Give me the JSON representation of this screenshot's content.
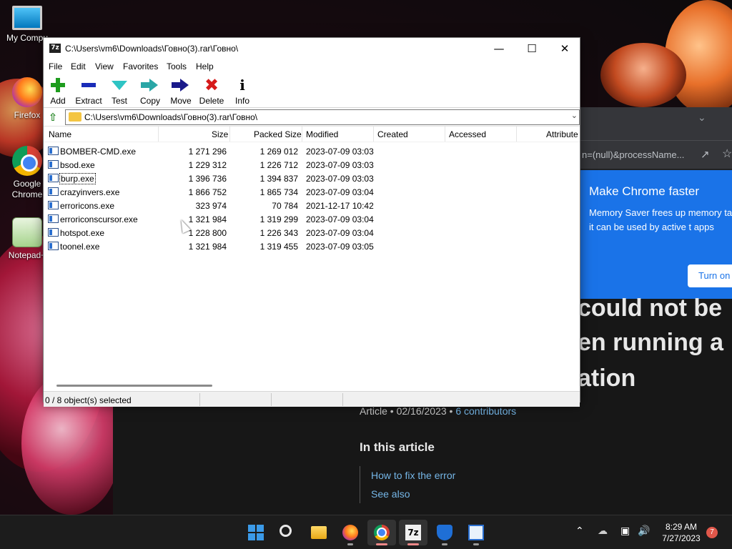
{
  "desktop": {
    "icons": [
      {
        "label": "My Compu"
      },
      {
        "label": "Firefox"
      },
      {
        "label": "Google Chrome"
      },
      {
        "label": "Notepad+"
      }
    ]
  },
  "browser": {
    "address_fragment": "n=(null)&processName...",
    "popup": {
      "title": "Make Chrome faster",
      "body": "Memory Saver frees up memory tabs so it can be used by active t apps",
      "button": "Turn on"
    },
    "article": {
      "heading_lines": [
        "could not be",
        "en running a",
        "ation"
      ],
      "meta_prefix": "Article • 02/16/2023 • ",
      "contributors": "6 contributors",
      "in_this_article": "In this article",
      "toc": [
        "How to fix the error",
        "See also"
      ]
    }
  },
  "window": {
    "title": "C:\\Users\\vm6\\Downloads\\Говно(3).rar\\Говно\\",
    "app_icon": "7z",
    "menu": [
      "File",
      "Edit",
      "View",
      "Favorites",
      "Tools",
      "Help"
    ],
    "toolbar": [
      "Add",
      "Extract",
      "Test",
      "Copy",
      "Move",
      "Delete",
      "Info"
    ],
    "path": "C:\\Users\\vm6\\Downloads\\Говно(3).rar\\Говно\\",
    "columns": [
      "Name",
      "Size",
      "Packed Size",
      "Modified",
      "Created",
      "Accessed",
      "Attribute"
    ],
    "files": [
      {
        "name": "BOMBER-CMD.exe",
        "size": "1 271 296",
        "packed": "1 269 012",
        "modified": "2023-07-09 03:03"
      },
      {
        "name": "bsod.exe",
        "size": "1 229 312",
        "packed": "1 226 712",
        "modified": "2023-07-09 03:03"
      },
      {
        "name": "burp.exe",
        "size": "1 396 736",
        "packed": "1 394 837",
        "modified": "2023-07-09 03:03"
      },
      {
        "name": "crazyinvers.exe",
        "size": "1 866 752",
        "packed": "1 865 734",
        "modified": "2023-07-09 03:04"
      },
      {
        "name": "erroricons.exe",
        "size": "323 974",
        "packed": "70 784",
        "modified": "2021-12-17 10:42"
      },
      {
        "name": "erroriconsсursor.exe",
        "size": "1 321 984",
        "packed": "1 319 299",
        "modified": "2023-07-09 03:04"
      },
      {
        "name": "hotspot.exe",
        "size": "1 228 800",
        "packed": "1 226 343",
        "modified": "2023-07-09 03:04"
      },
      {
        "name": "toonel.exe",
        "size": "1 321 984",
        "packed": "1 319 455",
        "modified": "2023-07-09 03:05"
      }
    ],
    "status": "0 / 8 object(s) selected"
  },
  "taskbar": {
    "apps": [
      "start-icon",
      "search-icon",
      "file-explorer-icon",
      "firefox-icon",
      "chrome-icon",
      "7zip-icon",
      "defender-icon",
      "app-icon"
    ],
    "time": "8:29 AM",
    "date": "7/27/2023",
    "notifications": "7"
  }
}
